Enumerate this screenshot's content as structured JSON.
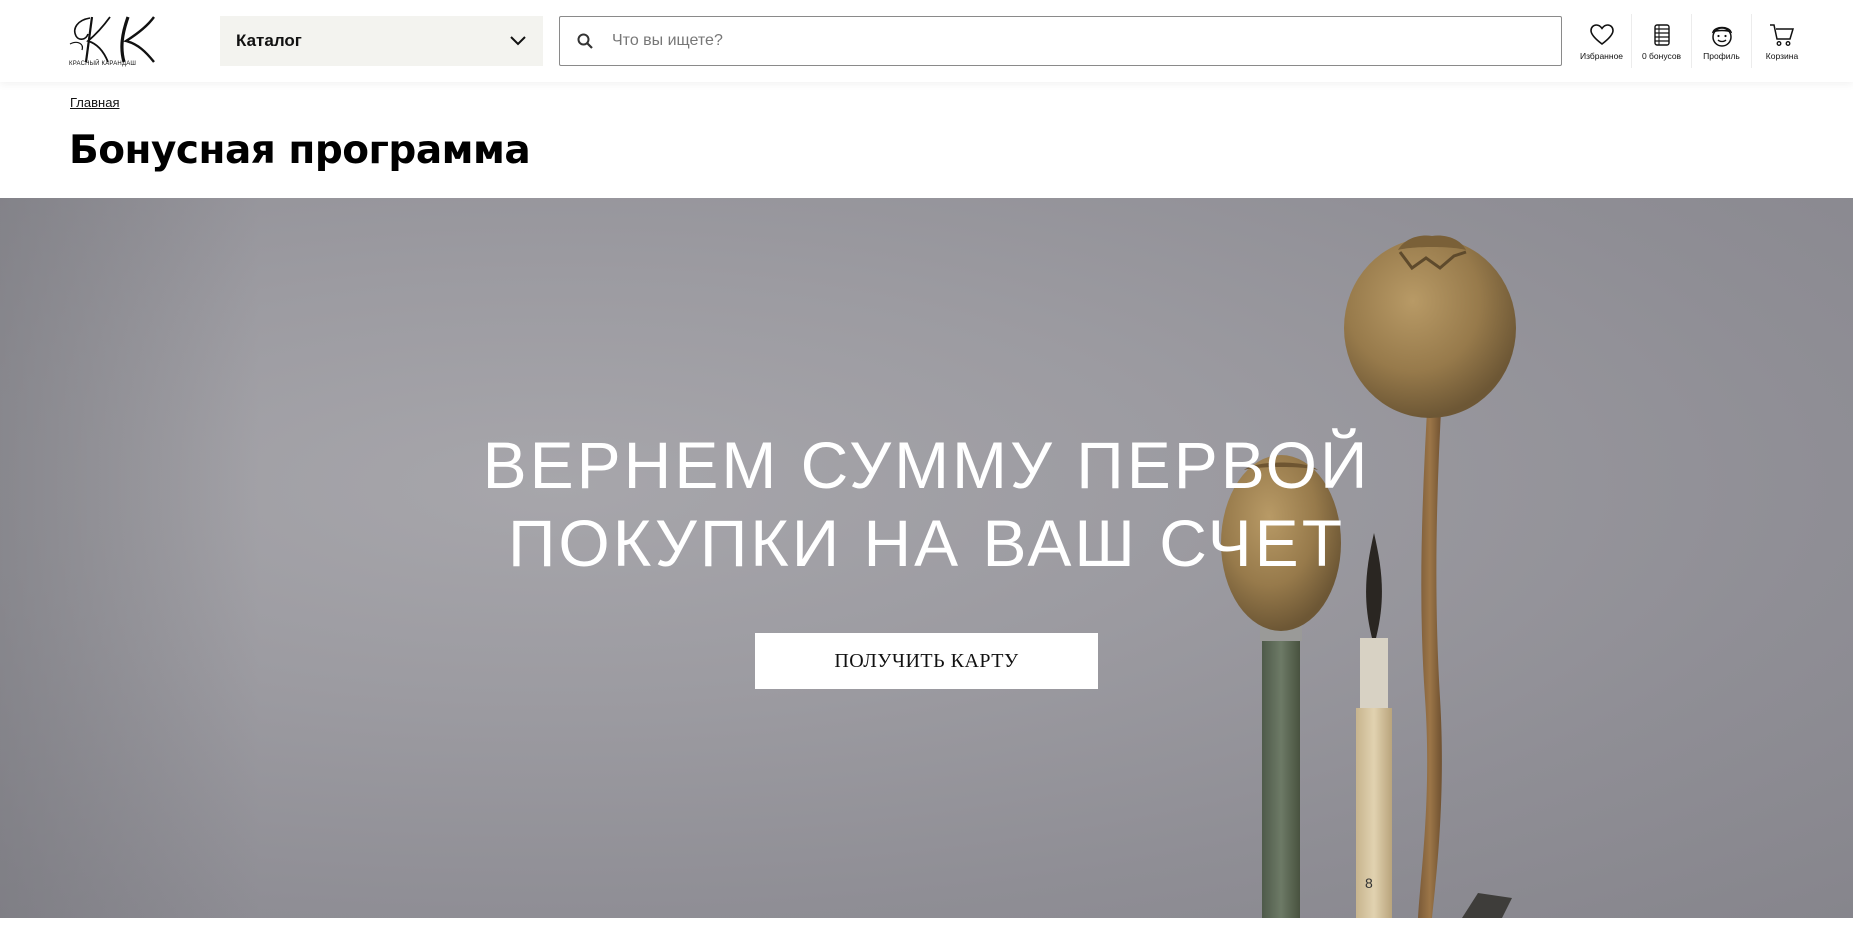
{
  "header": {
    "logo": {
      "text": "Kрасный Kарандаш",
      "monogram": "KK",
      "icon": "brand-logo"
    },
    "catalog": {
      "label": "Каталог",
      "icon": "chevron-down-icon"
    },
    "search": {
      "placeholder": "Что вы ищете?",
      "value": "",
      "icon": "search-icon"
    },
    "actions": [
      {
        "label": "Избранное",
        "icon": "heart-icon"
      },
      {
        "label": "0 бонусов",
        "icon": "coins-icon"
      },
      {
        "label": "Профиль",
        "icon": "profile-icon"
      },
      {
        "label": "Корзина",
        "icon": "cart-icon"
      }
    ]
  },
  "breadcrumb": {
    "home": "Главная"
  },
  "page": {
    "title": "Бонусная программа"
  },
  "hero": {
    "headline_line1": "ВЕРНЕМ СУММУ ПЕРВОЙ",
    "headline_line2": "ПОКУПКИ НА ВАШ СЧЕТ",
    "button_label": "ПОЛУЧИТЬ КАРТУ"
  },
  "colors": {
    "catalog_bg": "#f3f3ef",
    "hero_bg": "#9c9ba1",
    "text": "#111111",
    "white": "#ffffff"
  }
}
